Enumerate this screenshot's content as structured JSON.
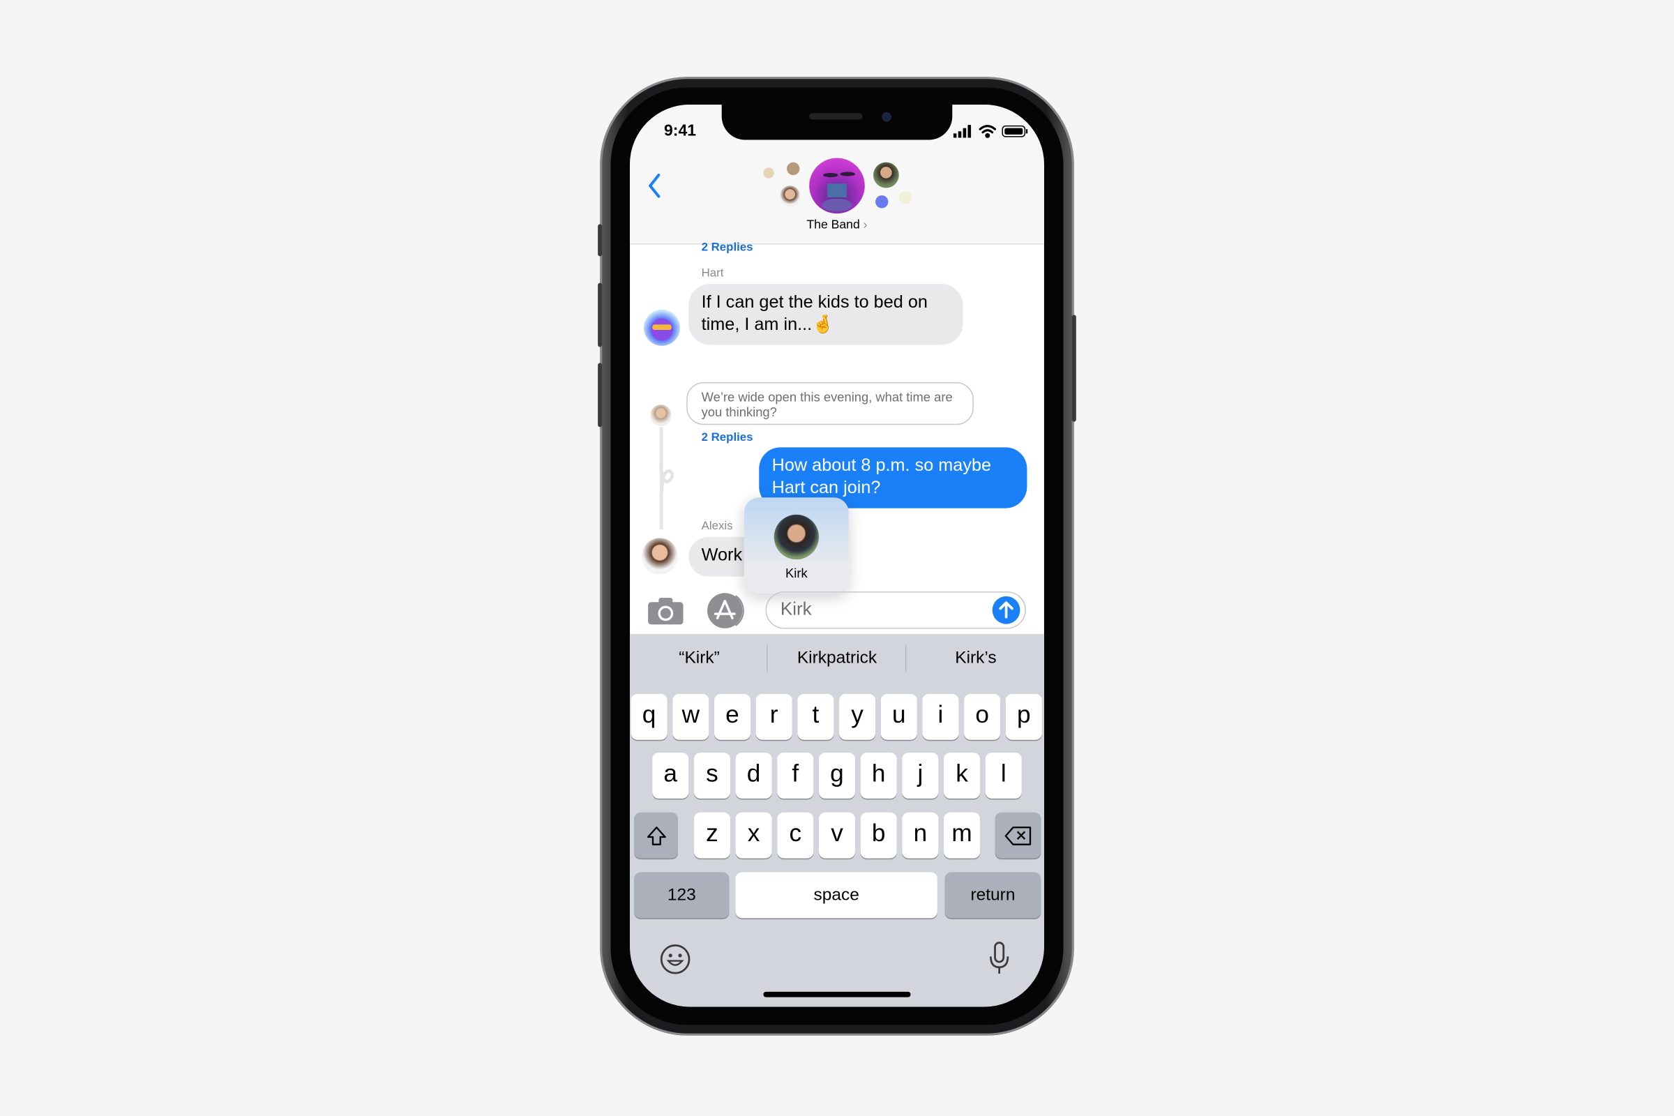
{
  "status_bar": {
    "time": "9:41",
    "icons": [
      "cellular-signal-icon",
      "wifi-icon",
      "battery-icon"
    ]
  },
  "header": {
    "back_icon": "chevron-left-icon",
    "group_name": "The Band",
    "chevron": "›"
  },
  "messages": [
    {
      "replies": "2 Replies"
    },
    {
      "sender": "Hart",
      "text": "If I can get the kids to bed on time, I am in...",
      "emoji": "🤞"
    },
    {
      "text": "We’re wide open this evening, what time are you thinking?",
      "replies": "2 Replies"
    },
    {
      "text": "How about 8 p.m. so maybe Hart can join?"
    },
    {
      "sender": "Alexis",
      "text": "Work"
    }
  ],
  "mention_popup": {
    "name": "Kirk"
  },
  "input": {
    "value": "Kirk",
    "camera_icon": "camera-icon",
    "apps_icon": "app-store-icon",
    "send_icon": "arrow-up-icon"
  },
  "colors": {
    "accent": "#1a80f7",
    "keyboard_bg": "#d2d5db",
    "bubble_gray": "#e9e9eb"
  },
  "keyboard": {
    "suggestions": [
      "“Kirk”",
      "Kirkpatrick",
      "Kirk’s"
    ],
    "row1": [
      "q",
      "w",
      "e",
      "r",
      "t",
      "y",
      "u",
      "i",
      "o",
      "p"
    ],
    "row2": [
      "a",
      "s",
      "d",
      "f",
      "g",
      "h",
      "j",
      "k",
      "l"
    ],
    "row3": [
      "z",
      "x",
      "c",
      "v",
      "b",
      "n",
      "m"
    ],
    "numbers": "123",
    "space": "space",
    "return": "return"
  }
}
